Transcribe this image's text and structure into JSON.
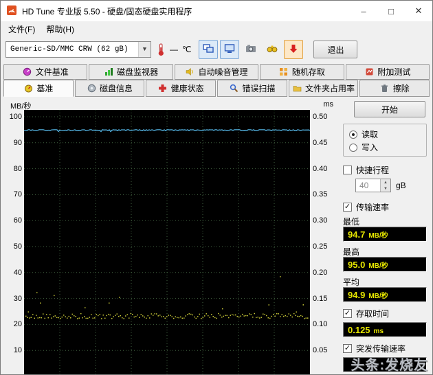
{
  "window": {
    "title": "HD Tune 专业版 5.50 - 硬盘/固态硬盘实用程序",
    "controls": {
      "minimize": "–",
      "maximize": "□",
      "close": "✕"
    }
  },
  "menu": {
    "file": "文件(F)",
    "help": "帮助(H)"
  },
  "toolbar": {
    "drive_select": "Generic-SD/MMC CRW (62 gB)",
    "temp_value": "—",
    "temp_unit": "℃",
    "exit_label": "退出",
    "buttons": [
      {
        "key": "copy-screen",
        "icon": "screens-icon",
        "highlight": "hl-blue"
      },
      {
        "key": "disk-monitor-view",
        "icon": "monitor-icon",
        "highlight": "hl-blue"
      },
      {
        "key": "screenshot",
        "icon": "camera-icon",
        "highlight": ""
      },
      {
        "key": "view-results",
        "icon": "binoculars-icon",
        "highlight": ""
      },
      {
        "key": "save-results",
        "icon": "download-icon",
        "highlight": "hl-orange"
      }
    ]
  },
  "tabs_row1": [
    {
      "key": "file-benchmark",
      "label": "文件基准",
      "icon": "file-benchmark-icon"
    },
    {
      "key": "disk-monitor",
      "label": "磁盘监视器",
      "icon": "disk-monitor-icon"
    },
    {
      "key": "aam",
      "label": "自动噪音管理",
      "icon": "speaker-icon"
    },
    {
      "key": "random-access",
      "label": "随机存取",
      "icon": "random-access-icon"
    },
    {
      "key": "extra-tests",
      "label": "附加测试",
      "icon": "extra-tests-icon"
    }
  ],
  "tabs_row2": [
    {
      "key": "benchmark",
      "label": "基准",
      "icon": "benchmark-icon",
      "active": true
    },
    {
      "key": "disk-info",
      "label": "磁盘信息",
      "icon": "disk-info-icon"
    },
    {
      "key": "health",
      "label": "健康状态",
      "icon": "health-icon"
    },
    {
      "key": "error-scan",
      "label": "错误扫描",
      "icon": "error-scan-icon"
    },
    {
      "key": "folder-usage",
      "label": "文件夹占用率",
      "icon": "folder-usage-icon"
    },
    {
      "key": "erase",
      "label": "擦除",
      "icon": "erase-icon"
    }
  ],
  "panel": {
    "start_label": "开始",
    "radio_read": "读取",
    "radio_write": "写入",
    "shortstroke_label": "快捷行程",
    "shortstroke_value": "40",
    "shortstroke_unit": "gB",
    "transfer_label": "传输速率",
    "min_label": "最低",
    "min_value": "94.7",
    "max_label": "最高",
    "max_value": "95.0",
    "avg_label": "平均",
    "avg_value": "94.9",
    "speed_unit": "MB/秒",
    "access_label": "存取时间",
    "access_value": "0.125",
    "access_unit": "ms",
    "burst_label": "突发传输速率",
    "burst_value": "",
    "burst_unit": ""
  },
  "watermark": "头条:发烧友",
  "chart_data": {
    "type": "line",
    "background": "#000000",
    "grid": {
      "color": "#41603f",
      "style": "dotted",
      "on": true
    },
    "left_axis": {
      "label": "MB/秒",
      "min": 0,
      "max": 100,
      "ticks": [
        "100",
        "90",
        "80",
        "70",
        "60",
        "50",
        "40",
        "30",
        "20",
        "10"
      ],
      "tick_values": [
        100,
        90,
        80,
        70,
        60,
        50,
        40,
        30,
        20,
        10
      ]
    },
    "right_axis": {
      "label": "ms",
      "min": 0,
      "max": 0.5,
      "ticks": [
        "0.50",
        "0.45",
        "0.40",
        "0.35",
        "0.30",
        "0.25",
        "0.20",
        "0.15",
        "0.10",
        "0.05"
      ]
    },
    "series": [
      {
        "name": "传输速率",
        "type": "line",
        "color": "#56b8e8",
        "unit": "MB/秒",
        "min": 94.7,
        "max": 95.0,
        "avg": 94.9
      },
      {
        "name": "存取时间",
        "type": "scatter",
        "color": "#c6c636",
        "unit": "ms",
        "band_min_ms": 0.112,
        "band_max_ms": 0.122,
        "reported_ms": 0.125,
        "outlier_max_ms": 0.21
      }
    ],
    "legend": "none"
  }
}
